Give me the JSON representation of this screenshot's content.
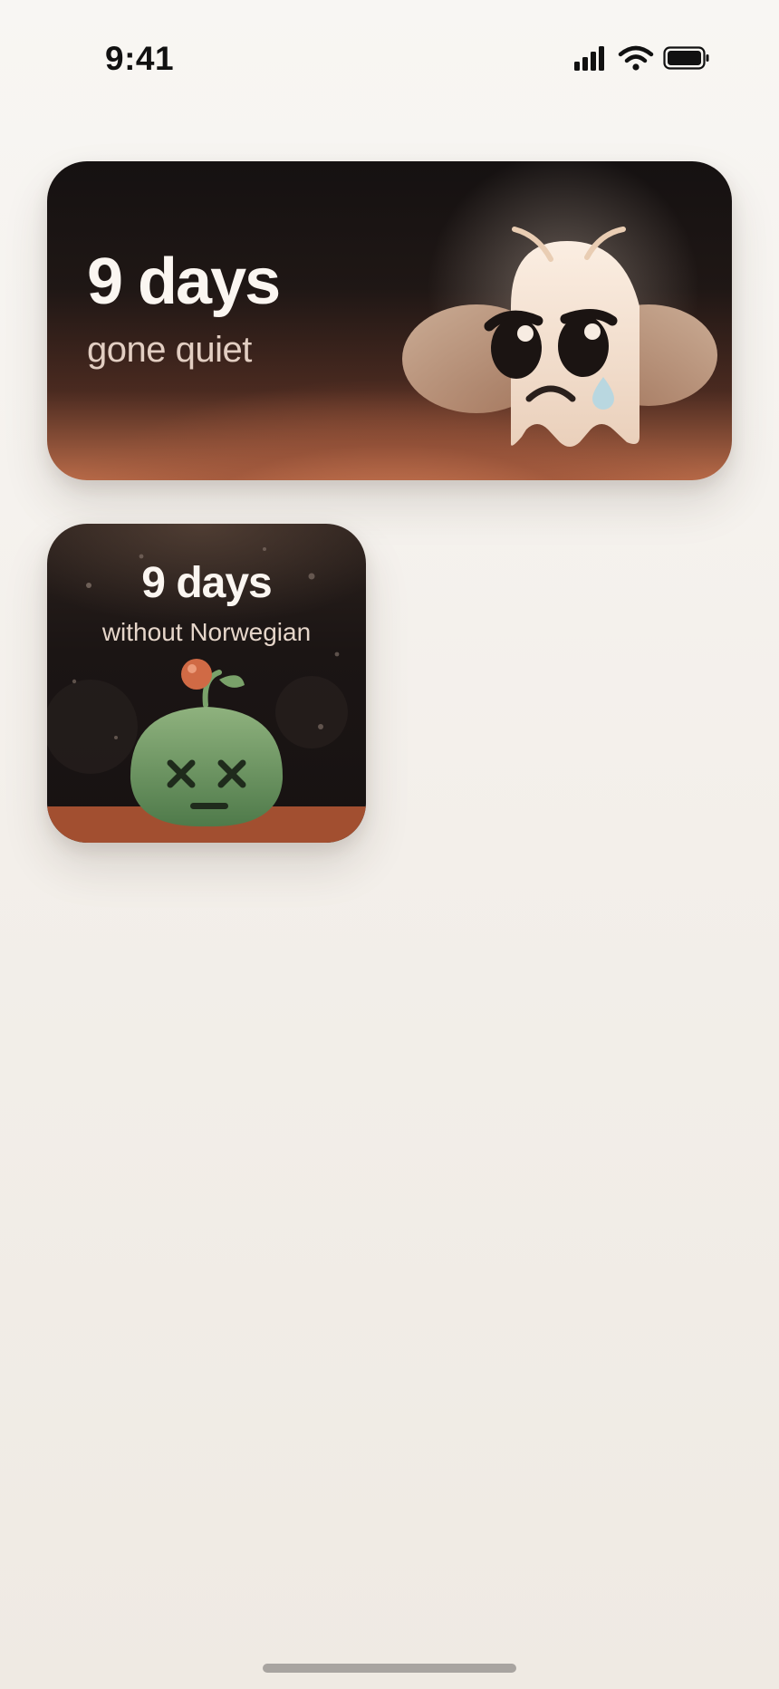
{
  "status_bar": {
    "time": "9:41",
    "icons": [
      "cellular-signal-icon",
      "wifi-icon",
      "battery-icon"
    ]
  },
  "widgets": {
    "large": {
      "count": "9 days",
      "subtitle": "gone quiet",
      "character": "sad-ghost-icon"
    },
    "small": {
      "count": "9 days",
      "subtitle": "without Norwegian",
      "character": "wilted-sprout-icon"
    }
  },
  "colors": {
    "background": "#f3efea",
    "widget_dark": "#171212",
    "widget_warm": "#b86a48",
    "text_primary": "#fbf6f1",
    "text_secondary": "#e2cec2",
    "plant_green": "#6f9a66",
    "berry_orange": "#d06a45"
  }
}
